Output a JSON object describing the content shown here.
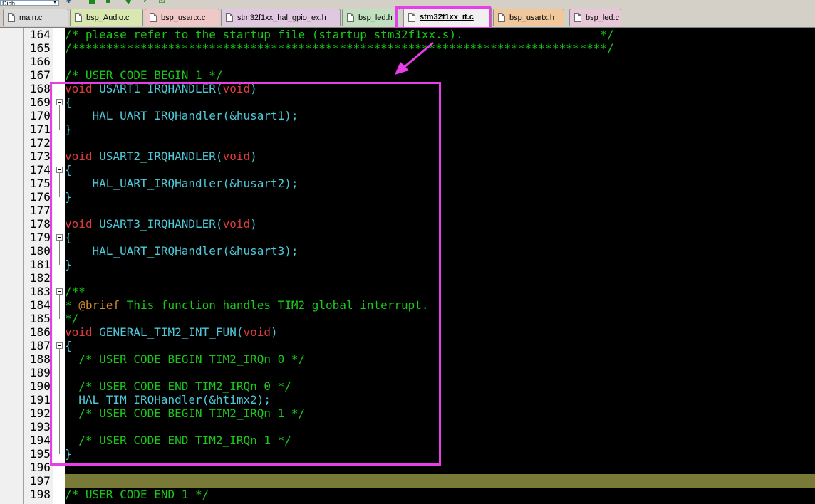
{
  "toolbar": {
    "combo_value": "Dish",
    "icons": [
      "settings-icon",
      "build-icon",
      "download-icon",
      "check-icon",
      "window-icon"
    ]
  },
  "tabs": [
    {
      "label": "main.c",
      "color": "#dcdcdc"
    },
    {
      "label": "bsp_Audio.c",
      "color": "#d8e8b0"
    },
    {
      "label": "bsp_usartx.c",
      "color": "#f0c8c8"
    },
    {
      "label": "stm32f1xx_hal_gpio_ex.h",
      "color": "#e0c8e0"
    },
    {
      "label": "bsp_led.h",
      "color": "#c0e0c0"
    },
    {
      "label": "stm32f1xx_it.c",
      "color": "#f0f0f0",
      "active": true
    },
    {
      "label": "bsp_usartx.h",
      "color": "#f0c89c"
    },
    {
      "label": "bsp_led.c",
      "color": "#e8c8d8"
    }
  ],
  "colors": {
    "comment": "#19c919",
    "keyword": "#e03c3c",
    "identifier": "#4ec9d8",
    "doc_tag": "#d28a2e",
    "highlight_line": "#7a7a38",
    "annotation": "#e83ee8"
  },
  "editor": {
    "lines": [
      {
        "no": "164",
        "tokens": [
          {
            "t": "/* please refer to the startup file (startup_stm32f1xx.s).                    */",
            "c": "comment"
          }
        ]
      },
      {
        "no": "165",
        "tokens": [
          {
            "t": "/******************************************************************************/",
            "c": "comment"
          }
        ]
      },
      {
        "no": "166",
        "tokens": []
      },
      {
        "no": "167",
        "tokens": [
          {
            "t": "/* USER CODE BEGIN 1 */",
            "c": "comment"
          }
        ]
      },
      {
        "no": "168",
        "tokens": [
          {
            "t": "void",
            "c": "kw"
          },
          {
            "t": " USART1_IRQHANDLER(",
            "c": "fn"
          },
          {
            "t": "void",
            "c": "kw"
          },
          {
            "t": ")",
            "c": "fn"
          }
        ]
      },
      {
        "no": "169",
        "tokens": [
          {
            "t": "{",
            "c": "fn"
          }
        ]
      },
      {
        "no": "170",
        "tokens": [
          {
            "t": "    HAL_UART_IRQHandler(&husart1);",
            "c": "fn"
          }
        ]
      },
      {
        "no": "171",
        "tokens": [
          {
            "t": "}",
            "c": "fn"
          }
        ]
      },
      {
        "no": "172",
        "tokens": []
      },
      {
        "no": "173",
        "tokens": [
          {
            "t": "void",
            "c": "kw"
          },
          {
            "t": " USART2_IRQHANDLER(",
            "c": "fn"
          },
          {
            "t": "void",
            "c": "kw"
          },
          {
            "t": ")",
            "c": "fn"
          }
        ]
      },
      {
        "no": "174",
        "tokens": [
          {
            "t": "{",
            "c": "fn"
          }
        ]
      },
      {
        "no": "175",
        "tokens": [
          {
            "t": "    HAL_UART_IRQHandler(&husart2);",
            "c": "fn"
          }
        ]
      },
      {
        "no": "176",
        "tokens": [
          {
            "t": "}",
            "c": "fn"
          }
        ]
      },
      {
        "no": "177",
        "tokens": []
      },
      {
        "no": "178",
        "tokens": [
          {
            "t": "void",
            "c": "kw"
          },
          {
            "t": " USART3_IRQHANDLER(",
            "c": "fn"
          },
          {
            "t": "void",
            "c": "kw"
          },
          {
            "t": ")",
            "c": "fn"
          }
        ]
      },
      {
        "no": "179",
        "tokens": [
          {
            "t": "{",
            "c": "fn"
          }
        ]
      },
      {
        "no": "180",
        "tokens": [
          {
            "t": "    HAL_UART_IRQHandler(&husart3);",
            "c": "fn"
          }
        ]
      },
      {
        "no": "181",
        "tokens": [
          {
            "t": "}",
            "c": "fn"
          }
        ]
      },
      {
        "no": "182",
        "tokens": []
      },
      {
        "no": "183",
        "tokens": [
          {
            "t": "/**",
            "c": "comment"
          }
        ]
      },
      {
        "no": "184",
        "tokens": [
          {
            "t": "* ",
            "c": "comment"
          },
          {
            "t": "@brief",
            "c": "tag"
          },
          {
            "t": " This function handles TIM2 global interrupt.",
            "c": "comment"
          }
        ]
      },
      {
        "no": "185",
        "tokens": [
          {
            "t": "*/",
            "c": "comment"
          }
        ]
      },
      {
        "no": "186",
        "tokens": [
          {
            "t": "void",
            "c": "kw"
          },
          {
            "t": " GENERAL_TIM2_INT_FUN(",
            "c": "fn"
          },
          {
            "t": "void",
            "c": "kw"
          },
          {
            "t": ")",
            "c": "fn"
          }
        ]
      },
      {
        "no": "187",
        "tokens": [
          {
            "t": "{",
            "c": "fn"
          }
        ]
      },
      {
        "no": "188",
        "tokens": [
          {
            "t": "  /* USER CODE BEGIN TIM2_IRQn 0 */",
            "c": "comment"
          }
        ]
      },
      {
        "no": "189",
        "tokens": []
      },
      {
        "no": "190",
        "tokens": [
          {
            "t": "  /* USER CODE END TIM2_IRQn 0 */",
            "c": "comment"
          }
        ]
      },
      {
        "no": "191",
        "tokens": [
          {
            "t": "  HAL_TIM_IRQHandler(&htimx2);",
            "c": "fn"
          }
        ]
      },
      {
        "no": "192",
        "tokens": [
          {
            "t": "  /* USER CODE BEGIN TIM2_IRQn 1 */",
            "c": "comment"
          }
        ]
      },
      {
        "no": "193",
        "tokens": []
      },
      {
        "no": "194",
        "tokens": [
          {
            "t": "  /* USER CODE END TIM2_IRQn 1 */",
            "c": "comment"
          }
        ]
      },
      {
        "no": "195",
        "tokens": [
          {
            "t": "}",
            "c": "fn"
          }
        ]
      },
      {
        "no": "196",
        "tokens": []
      },
      {
        "no": "197",
        "tokens": []
      },
      {
        "no": "198",
        "tokens": [
          {
            "t": "/* USER CODE END 1 */",
            "c": "comment"
          }
        ]
      }
    ]
  }
}
